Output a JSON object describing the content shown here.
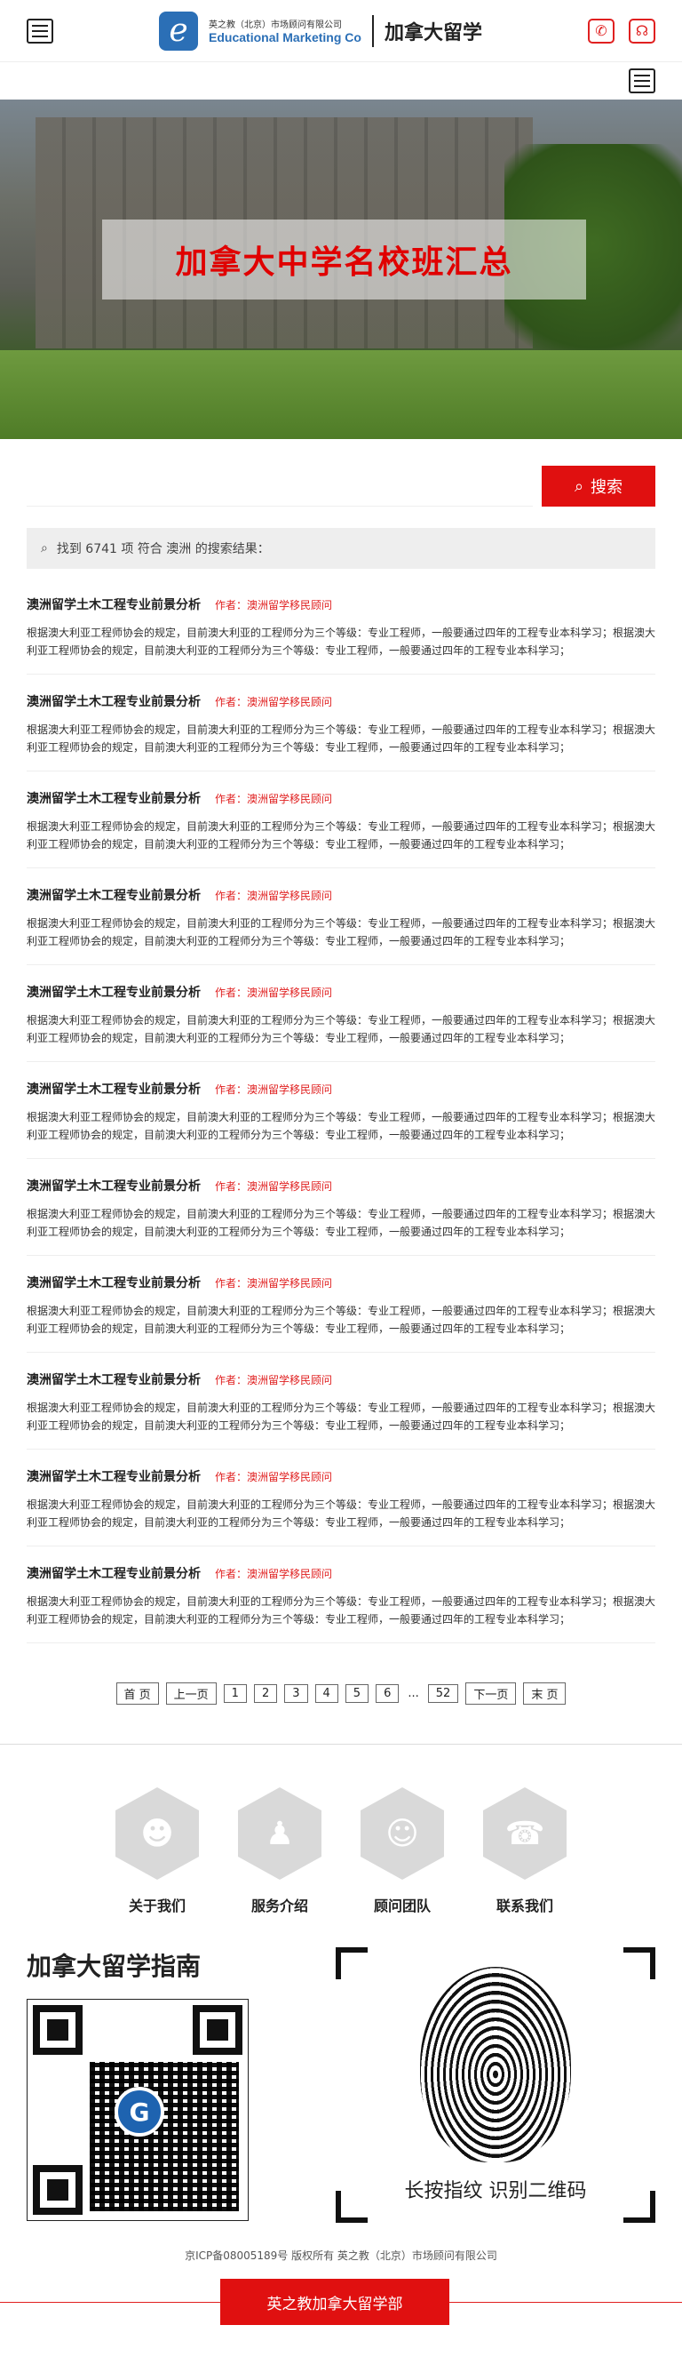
{
  "header": {
    "logo_letter": "e",
    "company_cn": "英之教（北京）市场顾问有限公司",
    "company_en": "Educational Marketing Co",
    "site_title": "加拿大留学"
  },
  "hero": {
    "banner_title": "加拿大中学名校班汇总"
  },
  "search": {
    "placeholder": "",
    "button_label": "搜索",
    "result_text": "找到 6741 项 符合 澳洲 的搜索结果："
  },
  "articles": [
    {
      "title": "澳洲留学土木工程专业前景分析",
      "author": "作者：澳洲留学移民顾问",
      "summary": "根据澳大利亚工程师协会的规定，目前澳大利亚的工程师分为三个等级：专业工程师，一般要通过四年的工程专业本科学习；根据澳大利亚工程师协会的规定，目前澳大利亚的工程师分为三个等级：专业工程师，一般要通过四年的工程专业本科学习；"
    },
    {
      "title": "澳洲留学土木工程专业前景分析",
      "author": "作者：澳洲留学移民顾问",
      "summary": "根据澳大利亚工程师协会的规定，目前澳大利亚的工程师分为三个等级：专业工程师，一般要通过四年的工程专业本科学习；根据澳大利亚工程师协会的规定，目前澳大利亚的工程师分为三个等级：专业工程师，一般要通过四年的工程专业本科学习；"
    },
    {
      "title": "澳洲留学土木工程专业前景分析",
      "author": "作者：澳洲留学移民顾问",
      "summary": "根据澳大利亚工程师协会的规定，目前澳大利亚的工程师分为三个等级：专业工程师，一般要通过四年的工程专业本科学习；根据澳大利亚工程师协会的规定，目前澳大利亚的工程师分为三个等级：专业工程师，一般要通过四年的工程专业本科学习；"
    },
    {
      "title": "澳洲留学土木工程专业前景分析",
      "author": "作者：澳洲留学移民顾问",
      "summary": "根据澳大利亚工程师协会的规定，目前澳大利亚的工程师分为三个等级：专业工程师，一般要通过四年的工程专业本科学习；根据澳大利亚工程师协会的规定，目前澳大利亚的工程师分为三个等级：专业工程师，一般要通过四年的工程专业本科学习；"
    },
    {
      "title": "澳洲留学土木工程专业前景分析",
      "author": "作者：澳洲留学移民顾问",
      "summary": "根据澳大利亚工程师协会的规定，目前澳大利亚的工程师分为三个等级：专业工程师，一般要通过四年的工程专业本科学习；根据澳大利亚工程师协会的规定，目前澳大利亚的工程师分为三个等级：专业工程师，一般要通过四年的工程专业本科学习；"
    },
    {
      "title": "澳洲留学土木工程专业前景分析",
      "author": "作者：澳洲留学移民顾问",
      "summary": "根据澳大利亚工程师协会的规定，目前澳大利亚的工程师分为三个等级：专业工程师，一般要通过四年的工程专业本科学习；根据澳大利亚工程师协会的规定，目前澳大利亚的工程师分为三个等级：专业工程师，一般要通过四年的工程专业本科学习；"
    },
    {
      "title": "澳洲留学土木工程专业前景分析",
      "author": "作者：澳洲留学移民顾问",
      "summary": "根据澳大利亚工程师协会的规定，目前澳大利亚的工程师分为三个等级：专业工程师，一般要通过四年的工程专业本科学习；根据澳大利亚工程师协会的规定，目前澳大利亚的工程师分为三个等级：专业工程师，一般要通过四年的工程专业本科学习；"
    },
    {
      "title": "澳洲留学土木工程专业前景分析",
      "author": "作者：澳洲留学移民顾问",
      "summary": "根据澳大利亚工程师协会的规定，目前澳大利亚的工程师分为三个等级：专业工程师，一般要通过四年的工程专业本科学习；根据澳大利亚工程师协会的规定，目前澳大利亚的工程师分为三个等级：专业工程师，一般要通过四年的工程专业本科学习；"
    },
    {
      "title": "澳洲留学土木工程专业前景分析",
      "author": "作者：澳洲留学移民顾问",
      "summary": "根据澳大利亚工程师协会的规定，目前澳大利亚的工程师分为三个等级：专业工程师，一般要通过四年的工程专业本科学习；根据澳大利亚工程师协会的规定，目前澳大利亚的工程师分为三个等级：专业工程师，一般要通过四年的工程专业本科学习；"
    },
    {
      "title": "澳洲留学土木工程专业前景分析",
      "author": "作者：澳洲留学移民顾问",
      "summary": "根据澳大利亚工程师协会的规定，目前澳大利亚的工程师分为三个等级：专业工程师，一般要通过四年的工程专业本科学习；根据澳大利亚工程师协会的规定，目前澳大利亚的工程师分为三个等级：专业工程师，一般要通过四年的工程专业本科学习；"
    },
    {
      "title": "澳洲留学土木工程专业前景分析",
      "author": "作者：澳洲留学移民顾问",
      "summary": "根据澳大利亚工程师协会的规定，目前澳大利亚的工程师分为三个等级：专业工程师，一般要通过四年的工程专业本科学习；根据澳大利亚工程师协会的规定，目前澳大利亚的工程师分为三个等级：专业工程师，一般要通过四年的工程专业本科学习；"
    }
  ],
  "pager": {
    "first": "首 页",
    "prev": "上一页",
    "pages": [
      "1",
      "2",
      "3",
      "4",
      "5",
      "6"
    ],
    "dots": "...",
    "last_num": "52",
    "next": "下一页",
    "last": "末 页"
  },
  "quick_links": [
    {
      "label": "关于我们",
      "icon": "people-icon"
    },
    {
      "label": "服务介绍",
      "icon": "meeting-icon"
    },
    {
      "label": "顾问团队",
      "icon": "team-icon"
    },
    {
      "label": "联系我们",
      "icon": "phone-icon"
    }
  ],
  "guide": {
    "title": "加拿大留学指南",
    "qr_logo": "G",
    "fp_label": "长按指纹 识别二维码"
  },
  "footer": {
    "icp": "京ICP备08005189号 版权所有 英之教（北京）市场顾问有限公司",
    "button": "英之教加拿大留学部"
  },
  "colors": {
    "accent": "#e01010",
    "brand": "#2b6fb6"
  }
}
